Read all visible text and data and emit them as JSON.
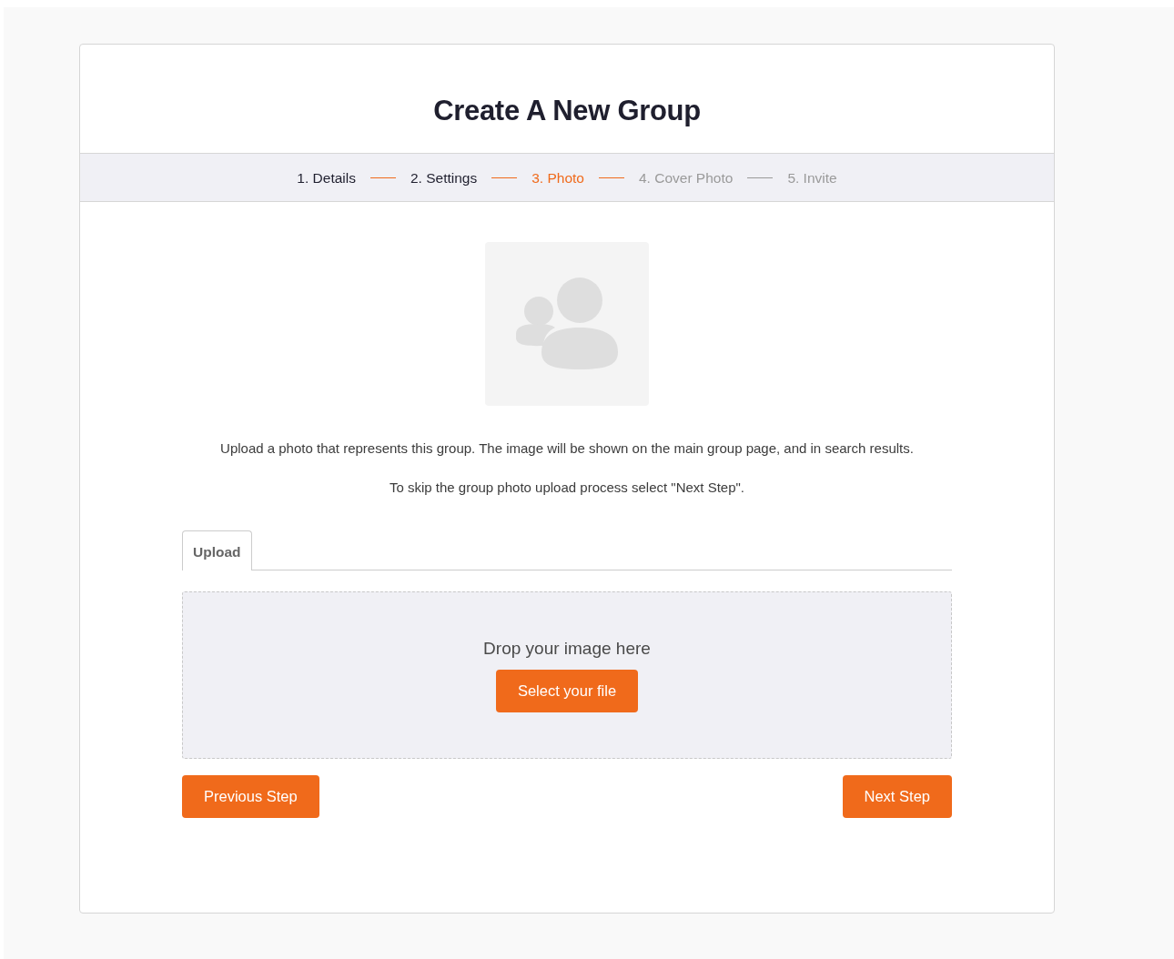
{
  "title": "Create A New Group",
  "steps": [
    {
      "label": "1. Details",
      "completed": true,
      "selected": false
    },
    {
      "label": "2. Settings",
      "completed": true,
      "selected": false
    },
    {
      "label": "3. Photo",
      "completed": false,
      "selected": true
    },
    {
      "label": "4. Cover Photo",
      "completed": false,
      "selected": false
    },
    {
      "label": "5. Invite",
      "completed": false,
      "selected": false
    }
  ],
  "description": "Upload a photo that represents this group. The image will be shown on the main group page, and in search results.",
  "skip_note": "To skip the group photo upload process select \"Next Step\".",
  "tabs": [
    {
      "label": "Upload",
      "selected": true
    }
  ],
  "dropzone": {
    "prompt": "Drop your image here",
    "button": "Select your file"
  },
  "buttons": {
    "previous": "Previous Step",
    "next": "Next Step"
  }
}
